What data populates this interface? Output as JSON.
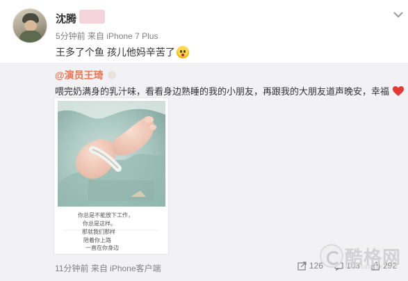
{
  "post": {
    "author": "沈腾",
    "time": "5分钟前",
    "from": "来自 iPhone 7 Plus",
    "text": "王多了个鱼 孩儿他妈辛苦了",
    "emoji": "surprised-face-emoji"
  },
  "repost": {
    "author": "@演员王琦",
    "text": "喂完奶满身的乳汁味，看看身边熟睡的我的小朋友，再跟我的大朋友道声晚安，幸福",
    "heart_icon": "heart-icon",
    "time": "11分钟前",
    "from": "来自 iPhone客户端",
    "actions": {
      "forward_count": "126",
      "comment_count": "103",
      "like_count": "292"
    },
    "photo": {
      "handwriting": [
        "你总是不能放下工作，",
        "你总是这样。",
        "那就我们那样",
        "陪着你上路",
        "一直在你身边"
      ]
    }
  },
  "watermark": {
    "text": "酷格网",
    "site": "www.cocoge.com"
  },
  "colors": {
    "repost_bg": "#f2f2f5",
    "author_link": "#eb7350",
    "meta": "#808080",
    "heart": "#e53935"
  }
}
